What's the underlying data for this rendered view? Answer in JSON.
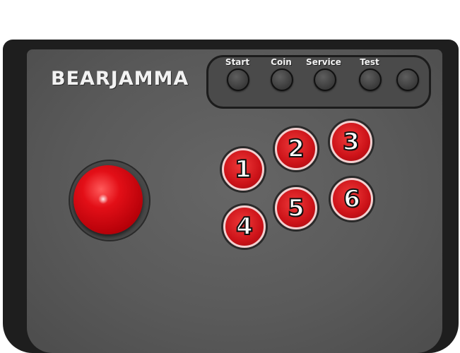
{
  "brand": {
    "logo_text": "BEARJAMMA"
  },
  "control_buttons": [
    {
      "label": "Start"
    },
    {
      "label": "Coin"
    },
    {
      "label": "Service"
    },
    {
      "label": "Test"
    },
    {
      "label": ""
    }
  ],
  "action_buttons": [
    {
      "label": "1"
    },
    {
      "label": "2"
    },
    {
      "label": "3"
    },
    {
      "label": "4"
    },
    {
      "label": "5"
    },
    {
      "label": "6"
    }
  ],
  "colors": {
    "housing": "#1e1e1e",
    "face": "#5a5a5a",
    "button_red": "#cc1218",
    "joystick_red": "#e30f17",
    "label_text": "#f2f2f2"
  }
}
